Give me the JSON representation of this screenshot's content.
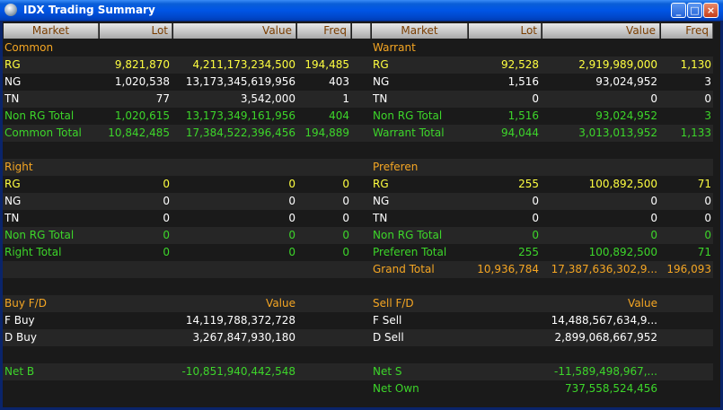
{
  "window": {
    "title": "IDX Trading Summary"
  },
  "headers": {
    "left": {
      "market": "Market",
      "lot": "Lot",
      "value": "Value",
      "freq": "Freq"
    },
    "right": {
      "market": "Market",
      "lot": "Lot",
      "value": "Value",
      "freq": "Freq"
    }
  },
  "rows": [
    {
      "left": {
        "label": "Common",
        "lot": "",
        "value": "",
        "freq": "",
        "color": "orange"
      },
      "right": {
        "label": "Warrant",
        "lot": "",
        "value": "",
        "freq": "",
        "color": "orange"
      }
    },
    {
      "left": {
        "label": "RG",
        "lot": "9,821,870",
        "value": "4,211,173,234,500",
        "freq": "194,485",
        "color": "yellow"
      },
      "right": {
        "label": "RG",
        "lot": "92,528",
        "value": "2,919,989,000",
        "freq": "1,130",
        "color": "yellow"
      }
    },
    {
      "left": {
        "label": "NG",
        "lot": "1,020,538",
        "value": "13,173,345,619,956",
        "freq": "403",
        "color": "white"
      },
      "right": {
        "label": "NG",
        "lot": "1,516",
        "value": "93,024,952",
        "freq": "3",
        "color": "white"
      }
    },
    {
      "left": {
        "label": "TN",
        "lot": "77",
        "value": "3,542,000",
        "freq": "1",
        "color": "white"
      },
      "right": {
        "label": "TN",
        "lot": "0",
        "value": "0",
        "freq": "0",
        "color": "white"
      }
    },
    {
      "left": {
        "label": "Non RG Total",
        "lot": "1,020,615",
        "value": "13,173,349,161,956",
        "freq": "404",
        "color": "green"
      },
      "right": {
        "label": "Non RG Total",
        "lot": "1,516",
        "value": "93,024,952",
        "freq": "3",
        "color": "green"
      }
    },
    {
      "left": {
        "label": "Common Total",
        "lot": "10,842,485",
        "value": "17,384,522,396,456",
        "freq": "194,889",
        "color": "green"
      },
      "right": {
        "label": "Warrant Total",
        "lot": "94,044",
        "value": "3,013,013,952",
        "freq": "1,133",
        "color": "green"
      }
    },
    {
      "left": {
        "label": "",
        "lot": "",
        "value": "",
        "freq": "",
        "color": "white"
      },
      "right": {
        "label": "",
        "lot": "",
        "value": "",
        "freq": "",
        "color": "white"
      }
    },
    {
      "left": {
        "label": "Right",
        "lot": "",
        "value": "",
        "freq": "",
        "color": "orange"
      },
      "right": {
        "label": "Preferen",
        "lot": "",
        "value": "",
        "freq": "",
        "color": "orange"
      }
    },
    {
      "left": {
        "label": "RG",
        "lot": "0",
        "value": "0",
        "freq": "0",
        "color": "yellow"
      },
      "right": {
        "label": "RG",
        "lot": "255",
        "value": "100,892,500",
        "freq": "71",
        "color": "yellow"
      }
    },
    {
      "left": {
        "label": "NG",
        "lot": "0",
        "value": "0",
        "freq": "0",
        "color": "white"
      },
      "right": {
        "label": "NG",
        "lot": "0",
        "value": "0",
        "freq": "0",
        "color": "white"
      }
    },
    {
      "left": {
        "label": "TN",
        "lot": "0",
        "value": "0",
        "freq": "0",
        "color": "white"
      },
      "right": {
        "label": "TN",
        "lot": "0",
        "value": "0",
        "freq": "0",
        "color": "white"
      }
    },
    {
      "left": {
        "label": "Non RG Total",
        "lot": "0",
        "value": "0",
        "freq": "0",
        "color": "green"
      },
      "right": {
        "label": "Non RG Total",
        "lot": "0",
        "value": "0",
        "freq": "0",
        "color": "green"
      }
    },
    {
      "left": {
        "label": "Right Total",
        "lot": "0",
        "value": "0",
        "freq": "0",
        "color": "green"
      },
      "right": {
        "label": "Preferen Total",
        "lot": "255",
        "value": "100,892,500",
        "freq": "71",
        "color": "green"
      }
    },
    {
      "left": {
        "label": "",
        "lot": "",
        "value": "",
        "freq": "",
        "color": "white"
      },
      "right": {
        "label": "Grand Total",
        "lot": "10,936,784",
        "value": "17,387,636,302,9...",
        "freq": "196,093",
        "color": "orange"
      }
    },
    {
      "left": {
        "label": "",
        "lot": "",
        "value": "",
        "freq": "",
        "color": "white"
      },
      "right": {
        "label": "",
        "lot": "",
        "value": "",
        "freq": "",
        "color": "white"
      }
    },
    {
      "left": {
        "label": "Buy F/D",
        "lot": "",
        "value": "Value",
        "freq": "",
        "color": "orange"
      },
      "right": {
        "label": "Sell F/D",
        "lot": "",
        "value": "Value",
        "freq": "",
        "color": "orange"
      }
    },
    {
      "left": {
        "label": "F Buy",
        "lot": "",
        "value": "14,119,788,372,728",
        "freq": "",
        "color": "white"
      },
      "right": {
        "label": "F Sell",
        "lot": "",
        "value": "14,488,567,634,9...",
        "freq": "",
        "color": "white"
      }
    },
    {
      "left": {
        "label": "D Buy",
        "lot": "",
        "value": "3,267,847,930,180",
        "freq": "",
        "color": "white"
      },
      "right": {
        "label": "D Sell",
        "lot": "",
        "value": "2,899,068,667,952",
        "freq": "",
        "color": "white"
      }
    },
    {
      "left": {
        "label": "",
        "lot": "",
        "value": "",
        "freq": "",
        "color": "white"
      },
      "right": {
        "label": "",
        "lot": "",
        "value": "",
        "freq": "",
        "color": "white"
      }
    },
    {
      "left": {
        "label": "Net B",
        "lot": "",
        "value": "-10,851,940,442,548",
        "freq": "",
        "color": "green"
      },
      "right": {
        "label": "Net S",
        "lot": "",
        "value": "-11,589,498,967,...",
        "freq": "",
        "color": "green"
      }
    },
    {
      "left": {
        "label": "",
        "lot": "",
        "value": "",
        "freq": "",
        "color": "white"
      },
      "right": {
        "label": "Net Own",
        "lot": "",
        "value": "737,558,524,456",
        "freq": "",
        "color": "green"
      }
    }
  ]
}
